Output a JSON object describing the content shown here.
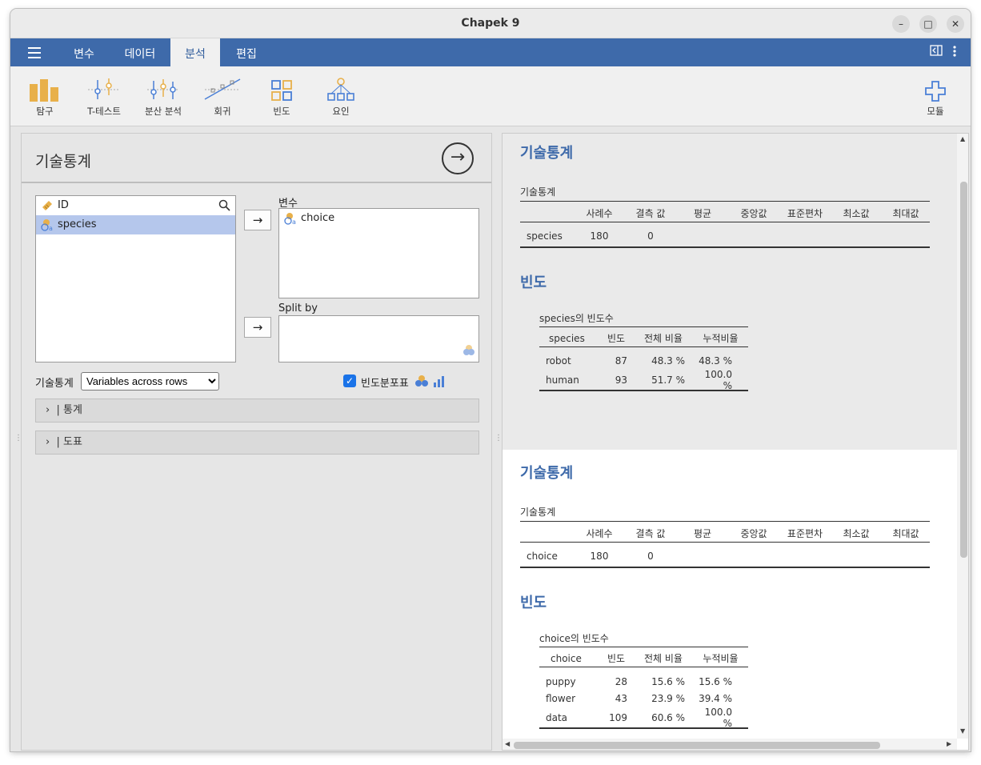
{
  "window": {
    "title": "Chapek 9"
  },
  "menu": {
    "tabs": [
      "변수",
      "데이터",
      "분석",
      "편집"
    ],
    "active": "분석"
  },
  "toolbar": {
    "tools": [
      "탐구",
      "T-테스트",
      "분산 분석",
      "회귀",
      "빈도",
      "요인"
    ],
    "modules_label": "모듈"
  },
  "analysis": {
    "title": "기술통계",
    "source_vars": [
      "ID",
      "species"
    ],
    "variables_label": "변수",
    "variables": [
      "choice"
    ],
    "splitby_label": "Split by",
    "layout_label": "기술통계",
    "layout_value": "Variables across rows",
    "freq_checkbox_label": "빈도분포표",
    "sections": [
      "통계",
      "도표"
    ]
  },
  "results": [
    {
      "heading": "기술통계",
      "table_title": "기술통계",
      "columns": [
        "",
        "사례수",
        "결측 값",
        "평균",
        "중앙값",
        "표준편차",
        "최소값",
        "최대값"
      ],
      "row": [
        "species",
        "180",
        "0",
        "",
        "",
        "",
        "",
        ""
      ],
      "freq_heading": "빈도",
      "freq_title": "species의 빈도수",
      "freq_columns": [
        "species",
        "빈도",
        "전체 비율",
        "누적비율"
      ],
      "freq_rows": [
        [
          "robot",
          "87",
          "48.3 %",
          "48.3 %"
        ],
        [
          "human",
          "93",
          "51.7 %",
          "100.0 %"
        ]
      ]
    },
    {
      "heading": "기술통계",
      "table_title": "기술통계",
      "columns": [
        "",
        "사례수",
        "결측 값",
        "평균",
        "중앙값",
        "표준편차",
        "최소값",
        "최대값"
      ],
      "row": [
        "choice",
        "180",
        "0",
        "",
        "",
        "",
        "",
        ""
      ],
      "freq_heading": "빈도",
      "freq_title": "choice의 빈도수",
      "freq_columns": [
        "choice",
        "빈도",
        "전체 비율",
        "누적비율"
      ],
      "freq_rows": [
        [
          "puppy",
          "28",
          "15.6 %",
          "15.6 %"
        ],
        [
          "flower",
          "43",
          "23.9 %",
          "39.4 %"
        ],
        [
          "data",
          "109",
          "60.6 %",
          "100.0 %"
        ]
      ]
    }
  ],
  "colors": {
    "accent": "#3e6aaa",
    "selection": "#b5c7ec",
    "icon_yellow": "#e8b04a",
    "icon_blue": "#4a7fd6"
  }
}
